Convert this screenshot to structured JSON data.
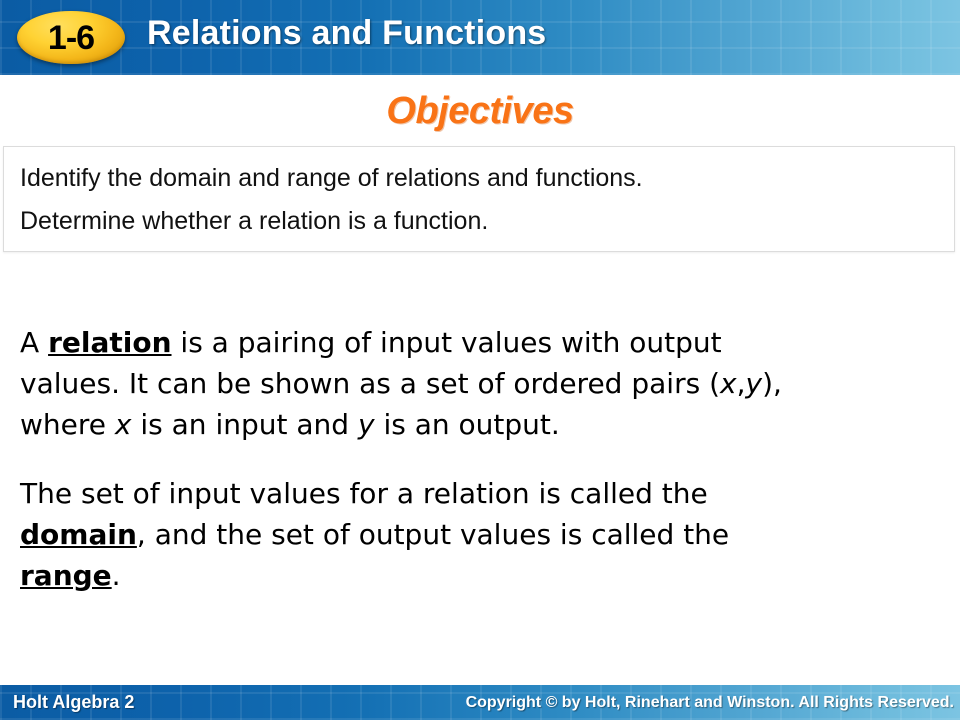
{
  "header": {
    "lesson_number": "1-6",
    "title": "Relations and Functions",
    "badge_color": "#ffd233",
    "band_color_left": "#0b5ca4",
    "band_color_right": "#7cc4e2"
  },
  "objectives": {
    "heading": "Objectives",
    "heading_color": "#f97316",
    "items": [
      "Identify the domain and range of relations and functions.",
      "Determine whether a relation is a function."
    ]
  },
  "body": {
    "paragraph_1": {
      "part_1": "A ",
      "term_1": "relation",
      "part_2": " is a pairing of input values with output values. It can be shown as a set of ordered pairs (",
      "var_x1": "x",
      "part_3": ",",
      "var_y1": "y",
      "part_4": "), where ",
      "var_x2": "x",
      "part_5": " is an input and ",
      "var_y2": "y",
      "part_6": " is an output."
    },
    "paragraph_2": {
      "part_1": "The set of input values for a relation is called the ",
      "term_1": "domain",
      "part_2": ", and the set of output values is called the ",
      "term_2": "range",
      "part_3": "."
    }
  },
  "footer": {
    "brand": "Holt Algebra 2",
    "copyright": "Copyright © by Holt, Rinehart and Winston. All Rights Reserved."
  }
}
